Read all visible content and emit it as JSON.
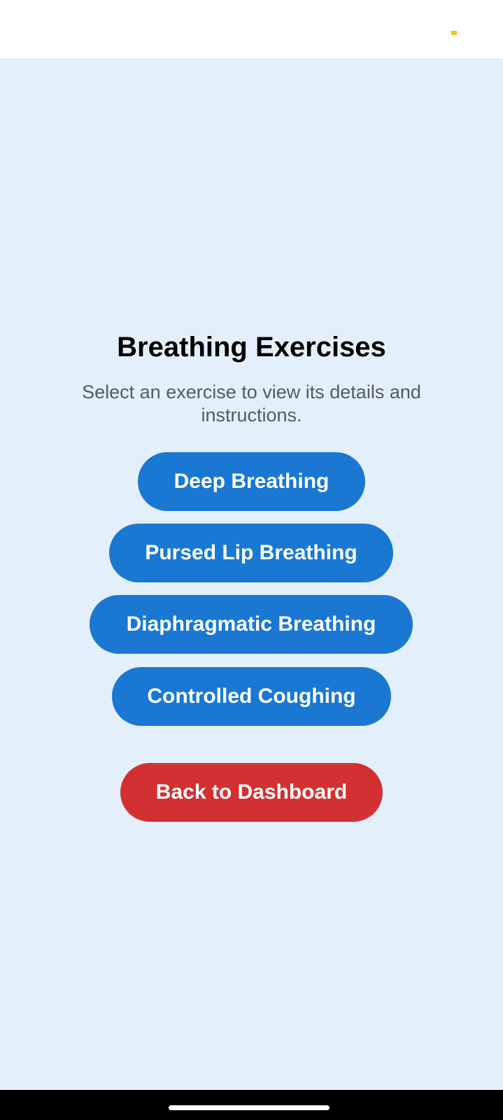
{
  "colors": {
    "background": "#e3f0fb",
    "primary_button": "#1a78d2",
    "danger_button": "#d33131",
    "status_indicator": "#f2c21a"
  },
  "status_bar": {
    "indicator_icon": "status-dot-icon"
  },
  "screen": {
    "title": "Breathing Exercises",
    "subtitle": "Select an exercise to view its details and instructions."
  },
  "exercises": [
    {
      "label": "Deep Breathing"
    },
    {
      "label": "Pursed Lip Breathing"
    },
    {
      "label": "Diaphragmatic Breathing"
    },
    {
      "label": "Controlled Coughing"
    }
  ],
  "back_button": {
    "label": "Back to Dashboard"
  }
}
